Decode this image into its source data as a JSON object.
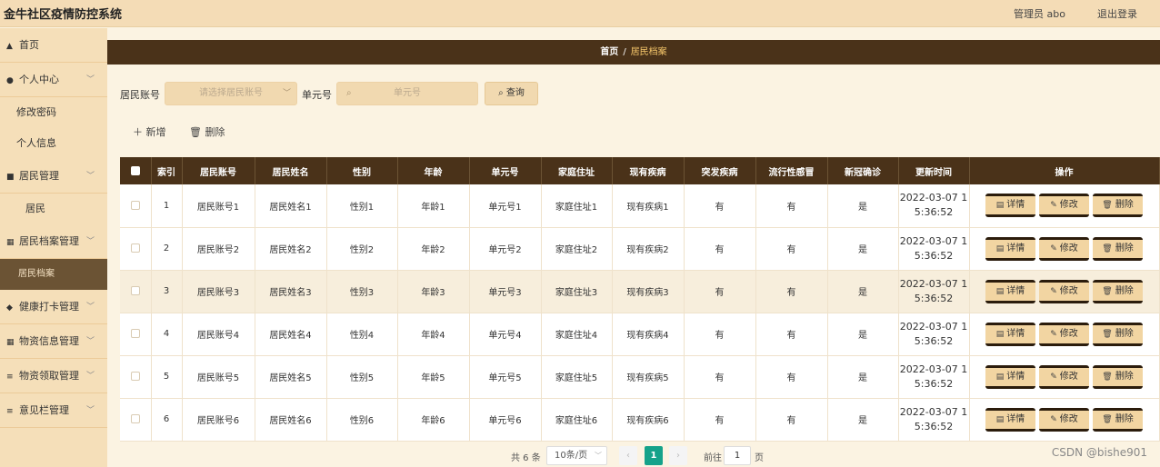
{
  "header": {
    "title": "金牛社区疫情防控系统",
    "user": "管理员 abo",
    "logout": "退出登录"
  },
  "sidebar": {
    "items": [
      {
        "name": "home",
        "label": "首页",
        "icon": "▲",
        "chev": ""
      },
      {
        "name": "personal",
        "label": "个人中心",
        "icon": "●",
        "chev": "﹀"
      },
      {
        "name": "change-password",
        "label": "修改密码",
        "sub": true
      },
      {
        "name": "personal-info",
        "label": "个人信息",
        "sub": true
      },
      {
        "name": "resident-mgmt",
        "label": "居民管理",
        "icon": "■",
        "chev": "﹀"
      },
      {
        "name": "resident",
        "label": "居民",
        "sub": true,
        "deep": true
      },
      {
        "name": "resident-archive-mgmt",
        "label": "居民档案管理",
        "icon": "▦",
        "chev": "﹀"
      },
      {
        "name": "resident-archive",
        "label": "居民档案",
        "sub": true,
        "active": true
      },
      {
        "name": "health-checkin-mgmt",
        "label": "健康打卡管理",
        "icon": "◆",
        "chev": "﹀"
      },
      {
        "name": "supplies-info-mgmt",
        "label": "物资信息管理",
        "icon": "▦",
        "chev": "﹀"
      },
      {
        "name": "supplies-claim-mgmt",
        "label": "物资领取管理",
        "icon": "≡",
        "chev": "﹀"
      },
      {
        "name": "feedback-mgmt",
        "label": "意见栏管理",
        "icon": "≡",
        "chev": "﹀"
      }
    ]
  },
  "breadcrumb": {
    "home": "首页",
    "sep": "/",
    "current": "居民档案"
  },
  "search": {
    "account_label": "居民账号",
    "account_placeholder": "请选择居民账号",
    "unit_label": "单元号",
    "unit_placeholder": "单元号",
    "search_button": "查询"
  },
  "actions": {
    "add": "新增",
    "delete": "删除"
  },
  "table": {
    "columns": [
      "索引",
      "居民账号",
      "居民姓名",
      "性别",
      "年龄",
      "单元号",
      "家庭住址",
      "现有疾病",
      "突发疾病",
      "流行性感冒",
      "新冠确诊",
      "更新时间",
      "操作"
    ],
    "rows": [
      {
        "idx": "1",
        "account": "居民账号1",
        "name": "居民姓名1",
        "gender": "性别1",
        "age": "年龄1",
        "unit": "单元号1",
        "address": "家庭住址1",
        "disease": "现有疾病1",
        "sudden": "有",
        "flu": "有",
        "covid": "是",
        "time1": "2022-03-07 1",
        "time2": "5:36:52"
      },
      {
        "idx": "2",
        "account": "居民账号2",
        "name": "居民姓名2",
        "gender": "性别2",
        "age": "年龄2",
        "unit": "单元号2",
        "address": "家庭住址2",
        "disease": "现有疾病2",
        "sudden": "有",
        "flu": "有",
        "covid": "是",
        "time1": "2022-03-07 1",
        "time2": "5:36:52"
      },
      {
        "idx": "3",
        "account": "居民账号3",
        "name": "居民姓名3",
        "gender": "性别3",
        "age": "年龄3",
        "unit": "单元号3",
        "address": "家庭住址3",
        "disease": "现有疾病3",
        "sudden": "有",
        "flu": "有",
        "covid": "是",
        "time1": "2022-03-07 1",
        "time2": "5:36:52"
      },
      {
        "idx": "4",
        "account": "居民账号4",
        "name": "居民姓名4",
        "gender": "性别4",
        "age": "年龄4",
        "unit": "单元号4",
        "address": "家庭住址4",
        "disease": "现有疾病4",
        "sudden": "有",
        "flu": "有",
        "covid": "是",
        "time1": "2022-03-07 1",
        "time2": "5:36:52"
      },
      {
        "idx": "5",
        "account": "居民账号5",
        "name": "居民姓名5",
        "gender": "性别5",
        "age": "年龄5",
        "unit": "单元号5",
        "address": "家庭住址5",
        "disease": "现有疾病5",
        "sudden": "有",
        "flu": "有",
        "covid": "是",
        "time1": "2022-03-07 1",
        "time2": "5:36:52"
      },
      {
        "idx": "6",
        "account": "居民账号6",
        "name": "居民姓名6",
        "gender": "性别6",
        "age": "年龄6",
        "unit": "单元号6",
        "address": "家庭住址6",
        "disease": "现有疾病6",
        "sudden": "有",
        "flu": "有",
        "covid": "是",
        "time1": "2022-03-07 1",
        "time2": "5:36:52"
      }
    ],
    "op_labels": {
      "detail": "详情",
      "edit": "修改",
      "delete": "删除"
    },
    "highlighted_row": 3
  },
  "pagination": {
    "total": "共 6 条",
    "page_size": "10条/页",
    "current": "1",
    "goto": "前往",
    "goto_value": "1",
    "unit": "页"
  },
  "watermark": "CSDN @bishe901",
  "colors": {
    "header_bg": "#f4dcb6",
    "dark_brown": "#4a3219",
    "accent_gold": "#f5c66a",
    "page_active": "#15a28a"
  }
}
